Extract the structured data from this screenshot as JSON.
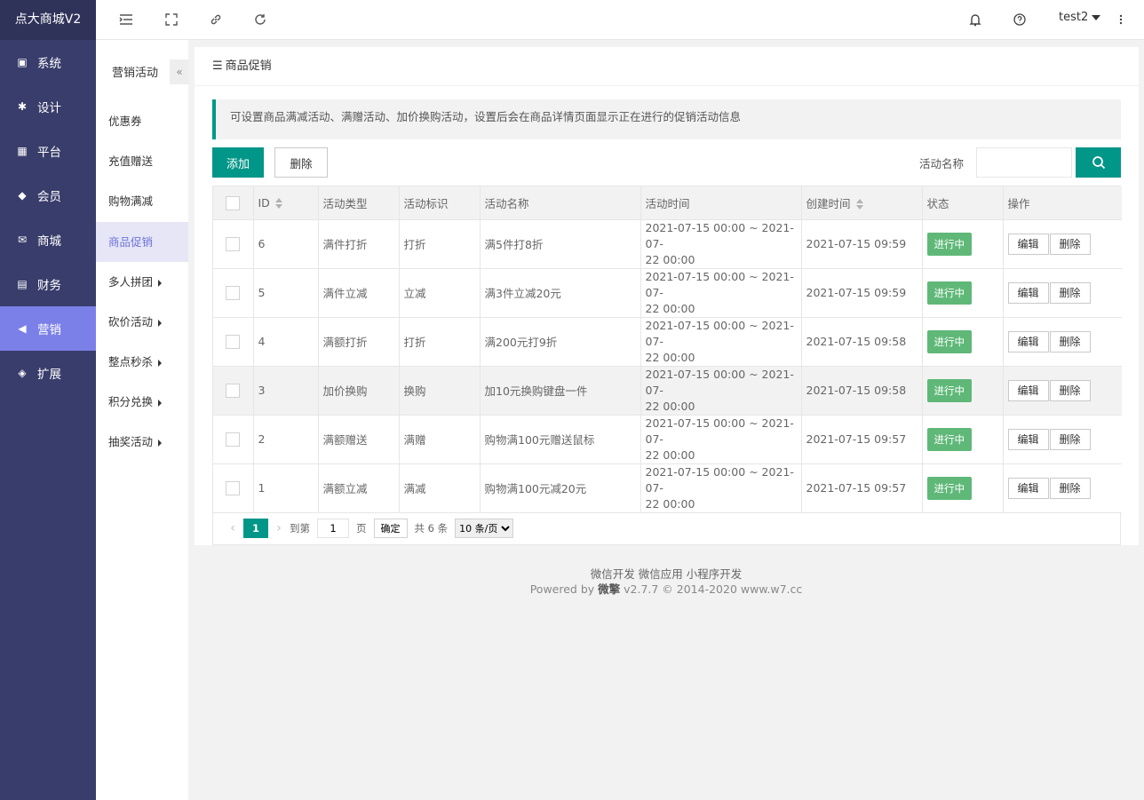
{
  "brand": "点大商城V2",
  "side_nav": [
    {
      "label": "系统",
      "icon": "monitor-icon"
    },
    {
      "label": "设计",
      "icon": "puzzle-icon"
    },
    {
      "label": "平台",
      "icon": "grid-icon"
    },
    {
      "label": "会员",
      "icon": "diamond-icon"
    },
    {
      "label": "商城",
      "icon": "mail-icon"
    },
    {
      "label": "财务",
      "icon": "wallet-icon"
    },
    {
      "label": "营销",
      "icon": "megaphone-icon"
    },
    {
      "label": "扩展",
      "icon": "cube-icon"
    }
  ],
  "header": {
    "user": "test2"
  },
  "sub_menu": {
    "title": "营销活动",
    "items": [
      "优惠券",
      "充值赠送",
      "购物满减",
      "商品促销",
      "多人拼团",
      "砍价活动",
      "整点秒杀",
      "积分兑换",
      "抽奖活动"
    ]
  },
  "card": {
    "title": "商品促销",
    "notice": "可设置商品满减活动、满赠活动、加价换购活动，设置后会在商品详情页面显示正在进行的促销活动信息",
    "add_label": "添加",
    "delete_label": "删除",
    "search_label": "活动名称"
  },
  "table": {
    "columns": [
      "ID",
      "活动类型",
      "活动标识",
      "活动名称",
      "活动时间",
      "创建时间",
      "状态",
      "操作"
    ],
    "rows": [
      {
        "id": "6",
        "type": "满件打折",
        "tag": "打折",
        "name": "满5件打8折",
        "time1": "2021-07-15 00:00 ~ 2021-07-",
        "time2": "22 00:00",
        "created": "2021-07-15 09:59",
        "status": "进行中",
        "edit": "编辑",
        "del": "删除"
      },
      {
        "id": "5",
        "type": "满件立减",
        "tag": "立减",
        "name": "满3件立减20元",
        "time1": "2021-07-15 00:00 ~ 2021-07-",
        "time2": "22 00:00",
        "created": "2021-07-15 09:59",
        "status": "进行中",
        "edit": "编辑",
        "del": "删除"
      },
      {
        "id": "4",
        "type": "满额打折",
        "tag": "打折",
        "name": "满200元打9折",
        "time1": "2021-07-15 00:00 ~ 2021-07-",
        "time2": "22 00:00",
        "created": "2021-07-15 09:58",
        "status": "进行中",
        "edit": "编辑",
        "del": "删除"
      },
      {
        "id": "3",
        "type": "加价换购",
        "tag": "换购",
        "name": "加10元换购键盘一件",
        "time1": "2021-07-15 00:00 ~ 2021-07-",
        "time2": "22 00:00",
        "created": "2021-07-15 09:58",
        "status": "进行中",
        "edit": "编辑",
        "del": "删除"
      },
      {
        "id": "2",
        "type": "满额赠送",
        "tag": "满赠",
        "name": "购物满100元赠送鼠标",
        "time1": "2021-07-15 00:00 ~ 2021-07-",
        "time2": "22 00:00",
        "created": "2021-07-15 09:57",
        "status": "进行中",
        "edit": "编辑",
        "del": "删除"
      },
      {
        "id": "1",
        "type": "满额立减",
        "tag": "满减",
        "name": "购物满100元减20元",
        "time1": "2021-07-15 00:00 ~ 2021-07-",
        "time2": "22 00:00",
        "created": "2021-07-15 09:57",
        "status": "进行中",
        "edit": "编辑",
        "del": "删除"
      }
    ]
  },
  "pager": {
    "current": "1",
    "goto_label": "到第",
    "goto_value": "1",
    "page_label": "页",
    "ok_label": "确定",
    "total": "共 6 条",
    "size": "10 条/页"
  },
  "footer": {
    "links": [
      "微信开发",
      "微信应用",
      "小程序开发"
    ],
    "powered_prefix": "Powered by ",
    "powered_brand": "微擎",
    "powered_suffix": " v2.7.7 © 2014-2020 www.w7.cc"
  },
  "colors": {
    "sidebar": "#393d6b",
    "active_nav": "#7b80e8",
    "primary": "#009688",
    "status": "#5fb878"
  }
}
